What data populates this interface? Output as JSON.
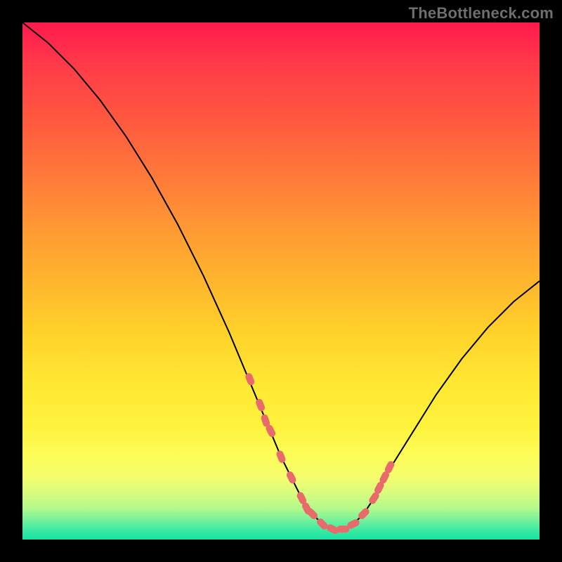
{
  "watermark": "TheBottleneck.com",
  "chart_data": {
    "type": "line",
    "title": "",
    "xlabel": "",
    "ylabel": "",
    "xlim": [
      0,
      100
    ],
    "ylim": [
      0,
      100
    ],
    "grid": false,
    "legend": false,
    "x": [
      0,
      5,
      10,
      15,
      20,
      25,
      30,
      35,
      40,
      45,
      50,
      52,
      54,
      56,
      58,
      60,
      62,
      64,
      66,
      68,
      70,
      75,
      80,
      85,
      90,
      95,
      100
    ],
    "y": [
      100,
      96,
      91,
      85,
      78,
      70,
      61,
      51,
      40,
      28,
      16,
      12,
      8,
      5,
      3,
      2,
      2,
      3,
      5,
      8,
      12,
      20,
      28,
      35,
      41,
      46,
      50
    ],
    "markers": {
      "x": [
        44,
        46,
        47,
        48,
        50,
        52,
        54,
        55,
        56,
        58,
        60,
        62,
        64,
        66,
        68,
        69,
        70,
        71
      ],
      "y": [
        31,
        26,
        23,
        21,
        16,
        12,
        8,
        6,
        5,
        3,
        2,
        2,
        3,
        5,
        8,
        10,
        12,
        14
      ]
    }
  }
}
